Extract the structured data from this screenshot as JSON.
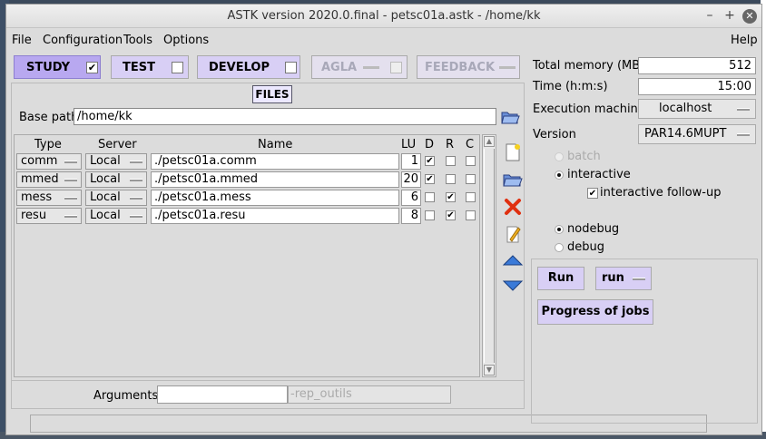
{
  "window": {
    "title": "ASTK version 2020.0.final - petsc01a.astk - /home/kk"
  },
  "menu": {
    "file": "File",
    "configuration": "Configuration",
    "tools": "Tools",
    "options": "Options",
    "help": "Help"
  },
  "modes": [
    {
      "label": "STUDY",
      "checked": "✔"
    },
    {
      "label": "TEST",
      "checked": ""
    },
    {
      "label": "DEVELOP",
      "checked": ""
    },
    {
      "label": "AGLA",
      "checked": ""
    },
    {
      "label": "FEEDBACK",
      "checked": ""
    }
  ],
  "files": {
    "label": "FILES",
    "base_path_label": "Base path",
    "base_path": "/home/kk",
    "headers": {
      "type": "Type",
      "server": "Server",
      "name": "Name",
      "lu": "LU",
      "d": "D",
      "r": "R",
      "c": "C"
    },
    "rows": [
      {
        "type": "comm",
        "server": "Local",
        "name": "./petsc01a.comm",
        "lu": "1",
        "d": "✔",
        "r": "",
        "c": ""
      },
      {
        "type": "mmed",
        "server": "Local",
        "name": "./petsc01a.mmed",
        "lu": "20",
        "d": "✔",
        "r": "",
        "c": ""
      },
      {
        "type": "mess",
        "server": "Local",
        "name": "./petsc01a.mess",
        "lu": "6",
        "d": "",
        "r": "✔",
        "c": ""
      },
      {
        "type": "resu",
        "server": "Local",
        "name": "./petsc01a.resu",
        "lu": "8",
        "d": "",
        "r": "✔",
        "c": ""
      }
    ]
  },
  "arguments": {
    "label": "Arguments",
    "value": "",
    "rep_outils": "-rep_outils"
  },
  "settings": {
    "total_memory_label": "Total memory (MB)",
    "total_memory": "512",
    "time_label": "Time (h:m:s)",
    "time": "15:00",
    "exec_machine_label": "Execution machine",
    "exec_machine": "localhost",
    "version_label": "Version",
    "version": "PAR14.6MUPT",
    "batch": "batch",
    "interactive": "interactive",
    "interactive_followup": "interactive follow-up",
    "nodebug": "nodebug",
    "debug": "debug"
  },
  "run": {
    "run_label": "Run",
    "run_mode": "run",
    "progress_label": "Progress of jobs"
  },
  "colors": {
    "mode_active": "#b8a8f0",
    "mode_inactive": "#d8cff5",
    "window_bg": "#dcdcdc"
  }
}
